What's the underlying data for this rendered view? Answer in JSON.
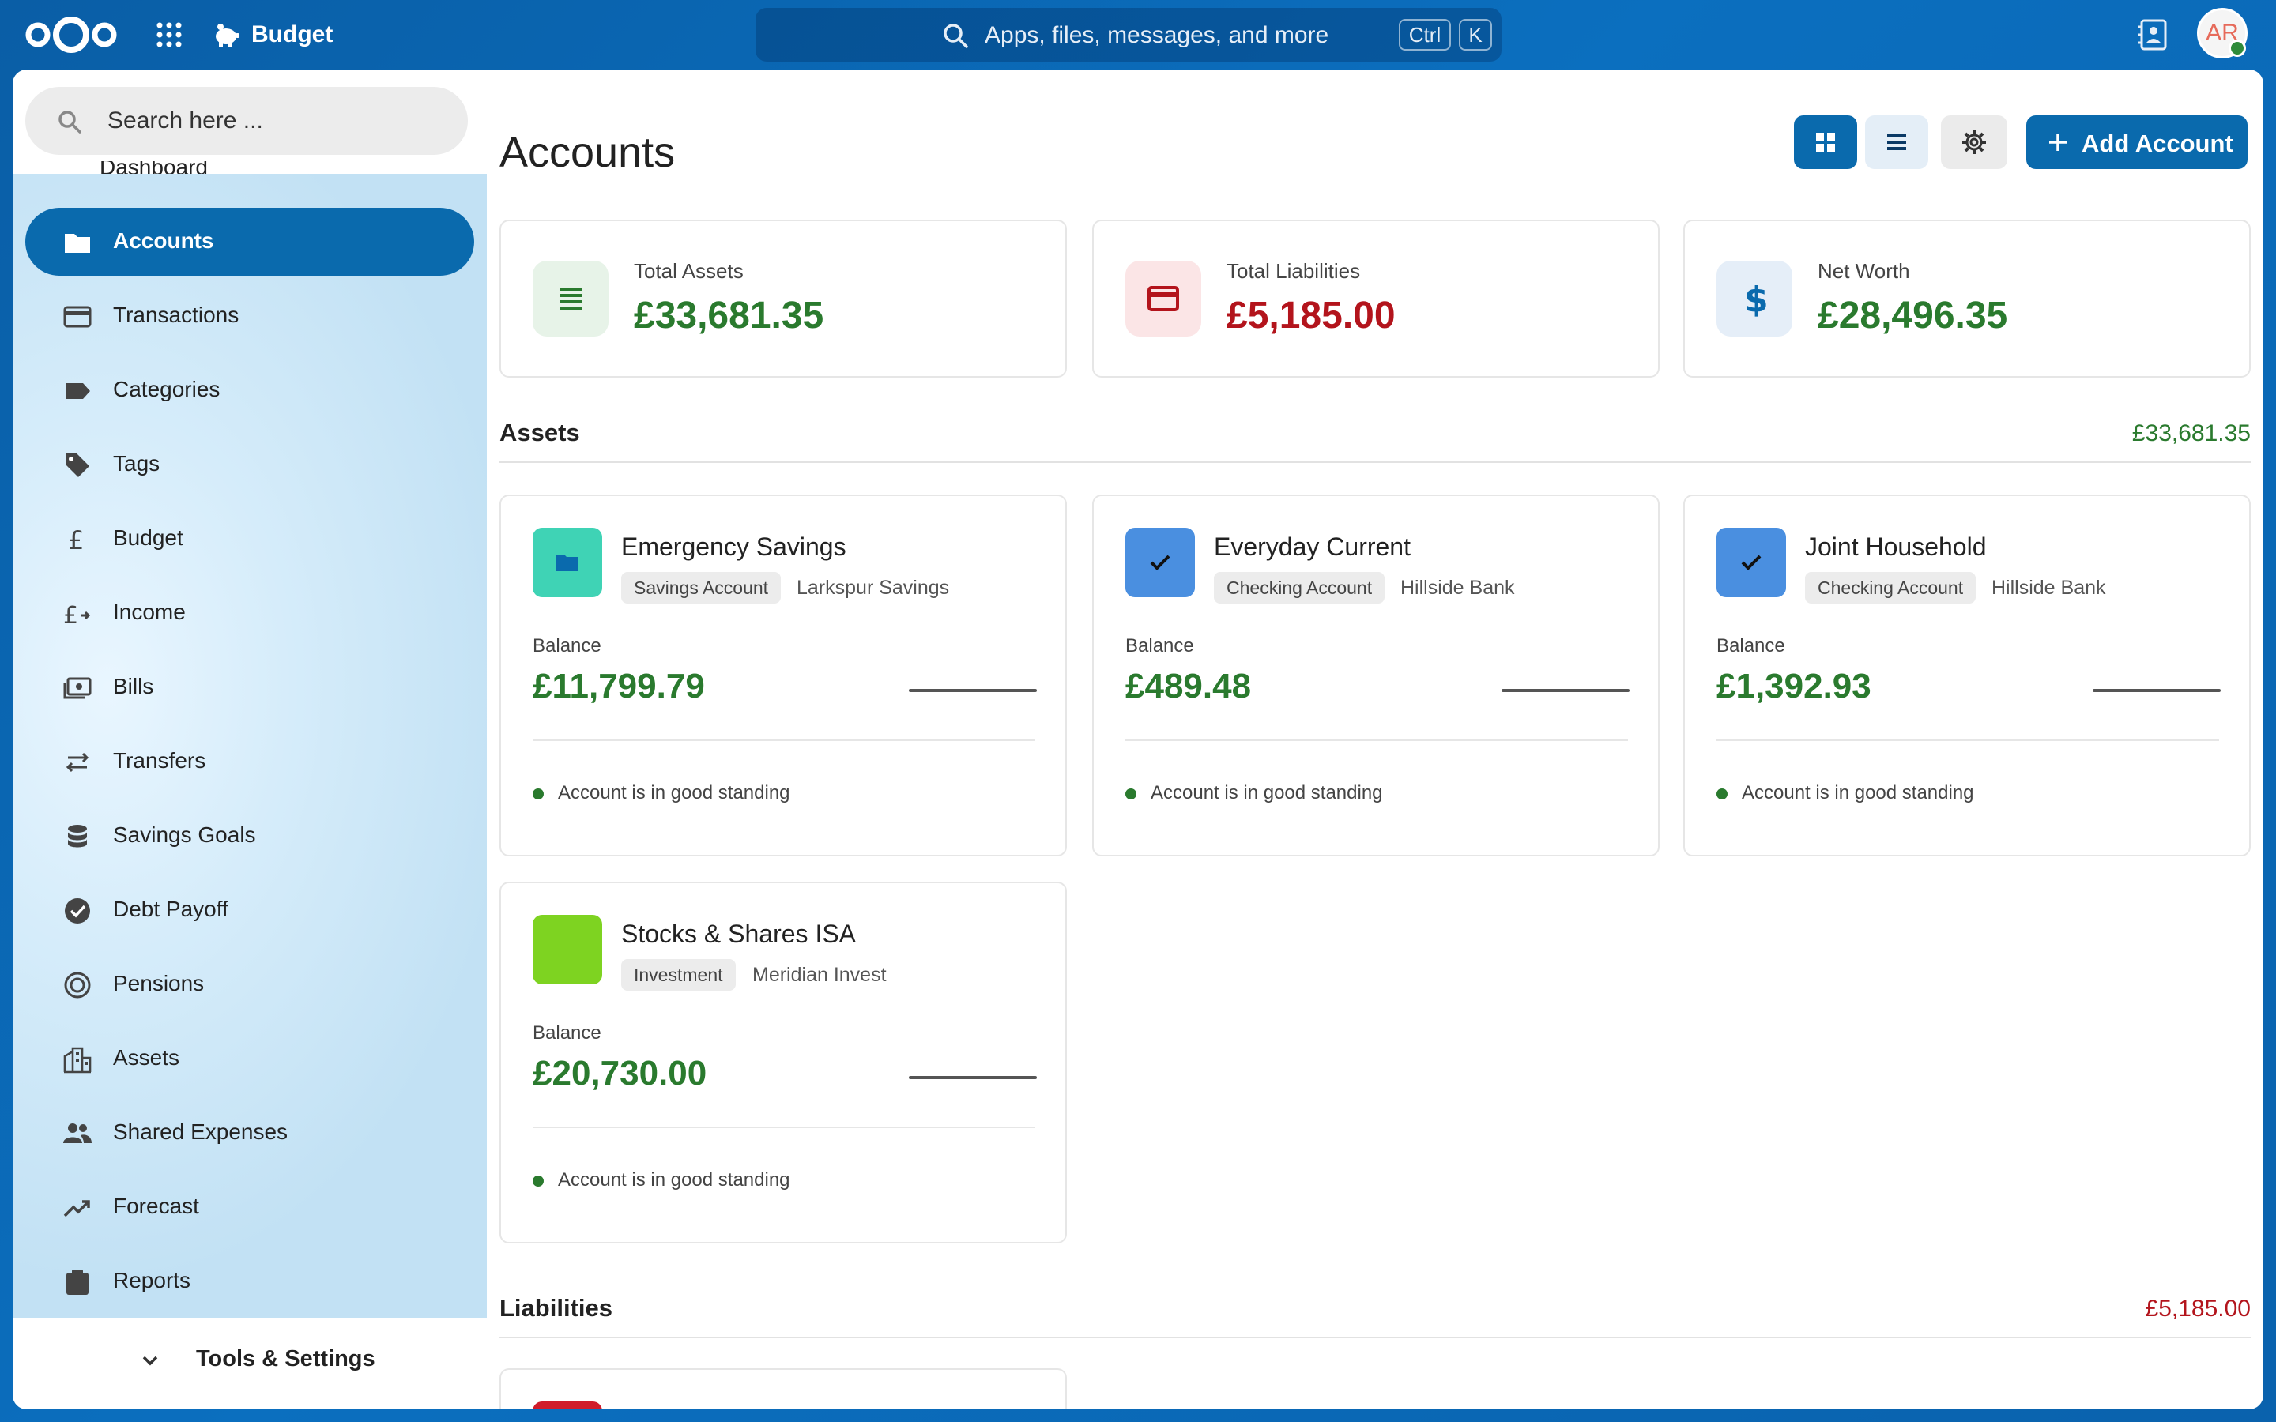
{
  "topbar": {
    "app_name": "Budget",
    "search_placeholder": "Apps, files, messages, and more",
    "shortcut_ctrl": "Ctrl",
    "shortcut_k": "K",
    "avatar_initials": "AR"
  },
  "sidebar": {
    "search_placeholder": "Search here ...",
    "clipped_item": "Dashboard",
    "items": [
      {
        "label": "Accounts",
        "icon": "folder-icon",
        "active": true
      },
      {
        "label": "Transactions",
        "icon": "credit-card-icon"
      },
      {
        "label": "Categories",
        "icon": "label-icon"
      },
      {
        "label": "Tags",
        "icon": "tag-icon"
      },
      {
        "label": "Budget",
        "icon": "pound-icon"
      },
      {
        "label": "Income",
        "icon": "pound-arrow-icon"
      },
      {
        "label": "Bills",
        "icon": "cash-icon"
      },
      {
        "label": "Transfers",
        "icon": "transfer-icon"
      },
      {
        "label": "Savings Goals",
        "icon": "database-icon"
      },
      {
        "label": "Debt Payoff",
        "icon": "check-circle-icon"
      },
      {
        "label": "Pensions",
        "icon": "target-icon"
      },
      {
        "label": "Assets",
        "icon": "buildings-icon"
      },
      {
        "label": "Shared Expenses",
        "icon": "people-icon"
      },
      {
        "label": "Forecast",
        "icon": "trend-icon"
      },
      {
        "label": "Reports",
        "icon": "clipboard-icon"
      }
    ],
    "bottom_label": "Tools & Settings"
  },
  "main": {
    "title": "Accounts",
    "add_button": "Add Account",
    "summary": [
      {
        "label": "Total Assets",
        "value": "£33,681.35",
        "tone": "green",
        "icon": "list-icon"
      },
      {
        "label": "Total Liabilities",
        "value": "£5,185.00",
        "tone": "red",
        "icon": "credit-card-icon"
      },
      {
        "label": "Net Worth",
        "value": "£28,496.35",
        "tone": "green",
        "icon": "dollar-icon"
      }
    ],
    "assets_section": {
      "title": "Assets",
      "total": "£33,681.35"
    },
    "accounts": [
      {
        "name": "Emergency Savings",
        "type": "Savings Account",
        "institution": "Larkspur Savings",
        "balance_label": "Balance",
        "balance": "£11,799.79",
        "status": "Account is in good standing",
        "color": "#3fd3b5",
        "icon": "folder-icon"
      },
      {
        "name": "Everyday Current",
        "type": "Checking Account",
        "institution": "Hillside Bank",
        "balance_label": "Balance",
        "balance": "£489.48",
        "status": "Account is in good standing",
        "color": "#4a8fe0",
        "icon": "check-icon"
      },
      {
        "name": "Joint Household",
        "type": "Checking Account",
        "institution": "Hillside Bank",
        "balance_label": "Balance",
        "balance": "£1,392.93",
        "status": "Account is in good standing",
        "color": "#4a8fe0",
        "icon": "check-icon"
      },
      {
        "name": "Stocks & Shares ISA",
        "type": "Investment",
        "institution": "Meridian Invest",
        "balance_label": "Balance",
        "balance": "£20,730.00",
        "status": "Account is in good standing",
        "color": "#7ed321",
        "icon": ""
      }
    ],
    "liabilities_section": {
      "title": "Liabilities",
      "total": "£5,185.00"
    }
  },
  "colors": {
    "primary": "#0a6aad",
    "positive": "#2a7a2e",
    "negative": "#b3141c"
  }
}
